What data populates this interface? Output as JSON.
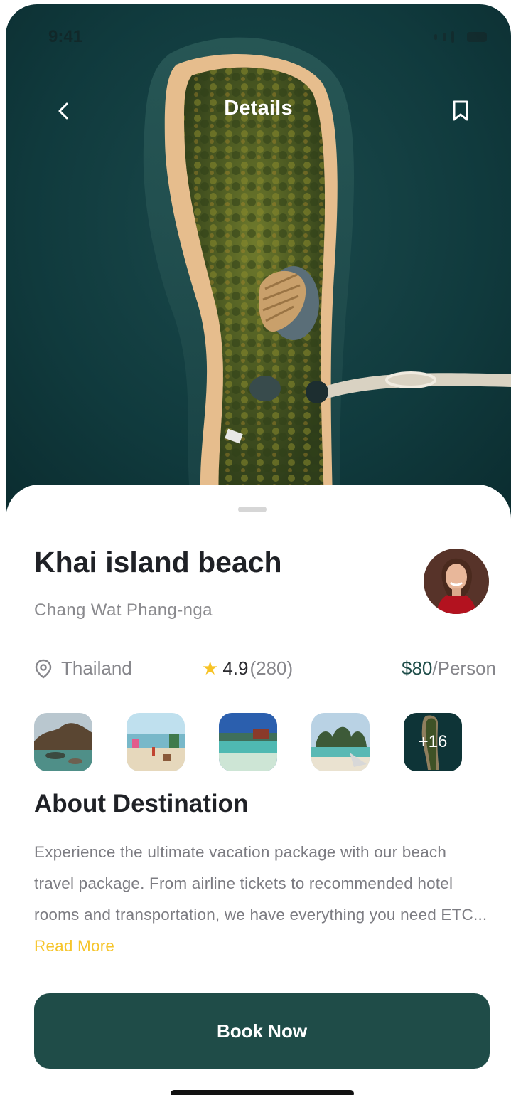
{
  "status_bar": {
    "time": "9:41"
  },
  "header": {
    "title": "Details",
    "back_icon": "chevron-left-icon",
    "bookmark_icon": "bookmark-icon"
  },
  "destination": {
    "name": "Khai island beach",
    "region": "Chang Wat Phang-nga",
    "country": "Thailand",
    "rating": "4.9",
    "reviews": "(280)",
    "price": "$80",
    "price_unit": "/Person"
  },
  "gallery": {
    "more_label": "+16"
  },
  "about": {
    "title": "About Destination",
    "text": "Experience the ultimate vacation package with our beach travel package. From airline tickets to recommended hotel rooms and transportation, we have everything you need ETC...",
    "read_more": "Read More"
  },
  "cta": {
    "book_label": "Book Now"
  },
  "colors": {
    "primary": "#1f4c48",
    "accent": "#f6c52c",
    "text_dark": "#1f2126",
    "text_muted": "#86868b"
  }
}
